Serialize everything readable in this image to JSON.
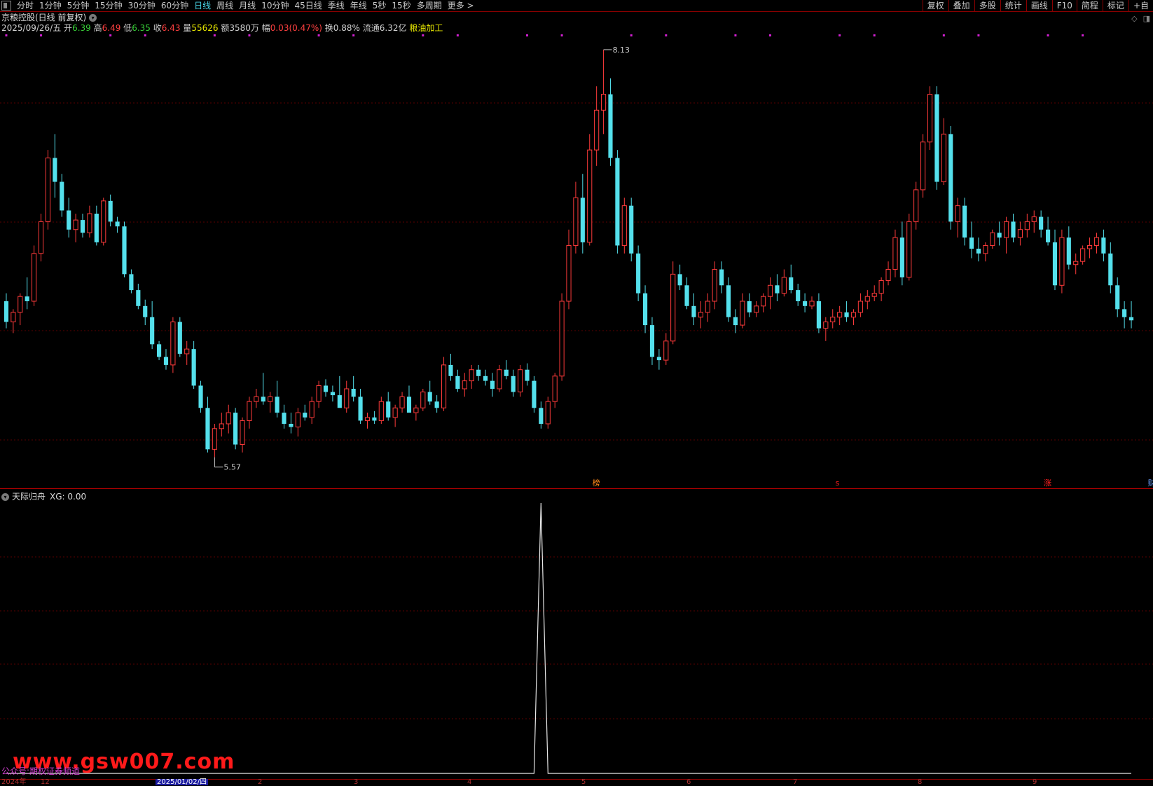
{
  "toolbar": {
    "periods": [
      "分时",
      "1分钟",
      "5分钟",
      "15分钟",
      "30分钟",
      "60分钟",
      "日线",
      "周线",
      "月线",
      "10分钟",
      "45日线",
      "季线",
      "年线",
      "5秒",
      "15秒",
      "多周期",
      "更多 >"
    ],
    "active_period": "日线",
    "right_buttons": [
      "复权",
      "叠加",
      "多股",
      "统计",
      "画线",
      "F10",
      "简程",
      "标记",
      "+自"
    ]
  },
  "stock": {
    "title": "京粮控股(日线 前复权)",
    "date": "2025/09/26/五",
    "open_label": "开",
    "open": "6.39",
    "high_label": "高",
    "high": "6.49",
    "low_label": "低",
    "low": "6.35",
    "close_label": "收",
    "close": "6.43",
    "volume_label": "量",
    "volume": "55626",
    "amount_label": "额",
    "amount": "3580万",
    "change_label": "幅",
    "change": "0.03(0.47%)",
    "turnover_label": "换",
    "turnover": "0.88%",
    "float_label": "流通",
    "float_cap": "6.32亿",
    "sector": "粮油加工"
  },
  "indicator": {
    "name": "天际归舟",
    "value_text": "XG: 0.00"
  },
  "markers": [
    {
      "text": "榜",
      "color": "#ff8a1a"
    },
    {
      "text": "s",
      "color": "#ff2020"
    },
    {
      "text": "涨",
      "color": "#ff2020"
    },
    {
      "text": "财",
      "color": "#6aa0ff"
    }
  ],
  "watermark": {
    "main": "www.gsw007.com",
    "sub": "公众号:期权证券频道"
  },
  "date_axis": {
    "labels": [
      "2024年",
      "12",
      "2025/01/02/四",
      "2",
      "3",
      "4",
      "5",
      "6",
      "7",
      "8",
      "9"
    ],
    "current": "2025/01/02/四"
  },
  "colors": {
    "up": "#ff3b3b",
    "down": "#54e0ec",
    "grid": "#5a0000",
    "indicator_line": "#e8e8e8",
    "signal_dot": "#d020d0"
  },
  "chart_data": {
    "type": "candlestick",
    "title": "京粮控股(日线 前复权)",
    "annotations": [
      {
        "label": "8.13",
        "kind": "max"
      },
      {
        "label": "5.57",
        "kind": "min"
      }
    ],
    "ohlc": [
      [
        6.55,
        6.6,
        6.38,
        6.42
      ],
      [
        6.42,
        6.5,
        6.35,
        6.48
      ],
      [
        6.48,
        6.6,
        6.4,
        6.58
      ],
      [
        6.58,
        6.7,
        6.5,
        6.55
      ],
      [
        6.55,
        6.9,
        6.52,
        6.85
      ],
      [
        6.85,
        7.1,
        6.8,
        7.05
      ],
      [
        7.05,
        7.5,
        7.0,
        7.45
      ],
      [
        7.45,
        7.6,
        7.2,
        7.3
      ],
      [
        7.3,
        7.35,
        7.08,
        7.12
      ],
      [
        7.12,
        7.2,
        6.95,
        7.0
      ],
      [
        7.0,
        7.1,
        6.92,
        7.06
      ],
      [
        7.06,
        7.1,
        6.95,
        6.98
      ],
      [
        6.98,
        7.15,
        6.95,
        7.1
      ],
      [
        7.1,
        7.15,
        6.9,
        6.92
      ],
      [
        6.92,
        7.2,
        6.9,
        7.18
      ],
      [
        7.18,
        7.22,
        7.02,
        7.05
      ],
      [
        7.05,
        7.08,
        6.98,
        7.02
      ],
      [
        7.02,
        7.05,
        6.7,
        6.72
      ],
      [
        6.72,
        6.75,
        6.6,
        6.62
      ],
      [
        6.62,
        6.66,
        6.5,
        6.52
      ],
      [
        6.52,
        6.56,
        6.4,
        6.45
      ],
      [
        6.45,
        6.55,
        6.25,
        6.28
      ],
      [
        6.28,
        6.3,
        6.18,
        6.2
      ],
      [
        6.2,
        6.25,
        6.12,
        6.15
      ],
      [
        6.15,
        6.45,
        6.1,
        6.42
      ],
      [
        6.42,
        6.45,
        6.2,
        6.22
      ],
      [
        6.22,
        6.3,
        6.15,
        6.25
      ],
      [
        6.25,
        6.3,
        6.0,
        6.02
      ],
      [
        6.02,
        6.05,
        5.85,
        5.88
      ],
      [
        5.88,
        5.95,
        5.6,
        5.62
      ],
      [
        5.62,
        5.78,
        5.57,
        5.75
      ],
      [
        5.75,
        5.85,
        5.7,
        5.78
      ],
      [
        5.78,
        5.9,
        5.72,
        5.85
      ],
      [
        5.85,
        5.88,
        5.62,
        5.65
      ],
      [
        5.65,
        5.82,
        5.6,
        5.8
      ],
      [
        5.8,
        5.95,
        5.75,
        5.92
      ],
      [
        5.92,
        6.0,
        5.88,
        5.95
      ],
      [
        5.95,
        6.1,
        5.9,
        5.92
      ],
      [
        5.92,
        5.98,
        5.85,
        5.95
      ],
      [
        5.95,
        6.05,
        5.82,
        5.85
      ],
      [
        5.85,
        5.9,
        5.75,
        5.78
      ],
      [
        5.78,
        5.85,
        5.72,
        5.76
      ],
      [
        5.76,
        5.88,
        5.7,
        5.85
      ],
      [
        5.85,
        5.9,
        5.8,
        5.82
      ],
      [
        5.82,
        5.95,
        5.78,
        5.92
      ],
      [
        5.92,
        6.05,
        5.88,
        6.02
      ],
      [
        6.02,
        6.06,
        5.95,
        5.98
      ],
      [
        5.98,
        6.02,
        5.92,
        5.96
      ],
      [
        5.96,
        6.08,
        5.9,
        5.88
      ],
      [
        5.88,
        6.05,
        5.85,
        6.0
      ],
      [
        6.0,
        6.08,
        5.92,
        5.95
      ],
      [
        5.95,
        6.0,
        5.78,
        5.8
      ],
      [
        5.8,
        5.85,
        5.75,
        5.82
      ],
      [
        5.82,
        5.86,
        5.78,
        5.8
      ],
      [
        5.8,
        5.95,
        5.78,
        5.92
      ],
      [
        5.92,
        5.98,
        5.8,
        5.82
      ],
      [
        5.82,
        5.9,
        5.76,
        5.88
      ],
      [
        5.88,
        5.98,
        5.85,
        5.95
      ],
      [
        5.95,
        6.02,
        5.9,
        5.85
      ],
      [
        5.85,
        5.9,
        5.8,
        5.88
      ],
      [
        5.88,
        6.0,
        5.86,
        5.98
      ],
      [
        5.98,
        6.05,
        5.9,
        5.92
      ],
      [
        5.92,
        5.96,
        5.85,
        5.88
      ],
      [
        5.88,
        6.2,
        5.86,
        6.15
      ],
      [
        6.15,
        6.22,
        6.05,
        6.08
      ],
      [
        6.08,
        6.12,
        5.98,
        6.0
      ],
      [
        6.0,
        6.1,
        5.95,
        6.05
      ],
      [
        6.05,
        6.15,
        6.0,
        6.12
      ],
      [
        6.12,
        6.15,
        6.05,
        6.08
      ],
      [
        6.08,
        6.12,
        6.02,
        6.05
      ],
      [
        6.05,
        6.1,
        5.95,
        6.0
      ],
      [
        6.0,
        6.15,
        5.98,
        6.12
      ],
      [
        6.12,
        6.18,
        6.06,
        6.08
      ],
      [
        6.08,
        6.12,
        5.95,
        5.98
      ],
      [
        5.98,
        6.15,
        5.95,
        6.12
      ],
      [
        6.12,
        6.16,
        6.02,
        6.05
      ],
      [
        6.05,
        6.08,
        5.85,
        5.88
      ],
      [
        5.88,
        5.92,
        5.75,
        5.78
      ],
      [
        5.78,
        5.95,
        5.75,
        5.92
      ],
      [
        5.92,
        6.1,
        5.88,
        6.08
      ],
      [
        6.08,
        6.6,
        6.05,
        6.55
      ],
      [
        6.55,
        7.0,
        6.5,
        6.9
      ],
      [
        6.9,
        7.3,
        6.85,
        7.2
      ],
      [
        7.2,
        7.35,
        6.85,
        6.92
      ],
      [
        6.92,
        7.6,
        6.9,
        7.5
      ],
      [
        7.5,
        7.9,
        7.4,
        7.75
      ],
      [
        7.75,
        8.13,
        7.6,
        7.85
      ],
      [
        7.85,
        7.95,
        7.4,
        7.45
      ],
      [
        7.45,
        7.5,
        6.85,
        6.9
      ],
      [
        6.9,
        7.2,
        6.85,
        7.15
      ],
      [
        7.15,
        7.2,
        6.8,
        6.85
      ],
      [
        6.85,
        6.9,
        6.55,
        6.6
      ],
      [
        6.6,
        6.65,
        6.35,
        6.4
      ],
      [
        6.4,
        6.45,
        6.15,
        6.2
      ],
      [
        6.2,
        6.25,
        6.12,
        6.18
      ],
      [
        6.18,
        6.35,
        6.15,
        6.3
      ],
      [
        6.3,
        6.8,
        6.28,
        6.72
      ],
      [
        6.72,
        6.78,
        6.62,
        6.65
      ],
      [
        6.65,
        6.7,
        6.5,
        6.52
      ],
      [
        6.52,
        6.6,
        6.4,
        6.45
      ],
      [
        6.45,
        6.55,
        6.38,
        6.48
      ],
      [
        6.48,
        6.6,
        6.42,
        6.55
      ],
      [
        6.55,
        6.8,
        6.5,
        6.75
      ],
      [
        6.75,
        6.8,
        6.6,
        6.65
      ],
      [
        6.65,
        6.7,
        6.42,
        6.45
      ],
      [
        6.45,
        6.5,
        6.35,
        6.4
      ],
      [
        6.4,
        6.6,
        6.38,
        6.55
      ],
      [
        6.55,
        6.6,
        6.45,
        6.48
      ],
      [
        6.48,
        6.55,
        6.45,
        6.52
      ],
      [
        6.52,
        6.6,
        6.48,
        6.58
      ],
      [
        6.58,
        6.7,
        6.5,
        6.65
      ],
      [
        6.65,
        6.72,
        6.55,
        6.6
      ],
      [
        6.6,
        6.75,
        6.58,
        6.7
      ],
      [
        6.7,
        6.78,
        6.6,
        6.62
      ],
      [
        6.62,
        6.66,
        6.52,
        6.55
      ],
      [
        6.55,
        6.6,
        6.48,
        6.52
      ],
      [
        6.52,
        6.58,
        6.5,
        6.55
      ],
      [
        6.55,
        6.6,
        6.35,
        6.38
      ],
      [
        6.38,
        6.45,
        6.3,
        6.42
      ],
      [
        6.42,
        6.5,
        6.38,
        6.45
      ],
      [
        6.45,
        6.52,
        6.4,
        6.48
      ],
      [
        6.48,
        6.55,
        6.42,
        6.45
      ],
      [
        6.45,
        6.5,
        6.4,
        6.48
      ],
      [
        6.48,
        6.6,
        6.45,
        6.55
      ],
      [
        6.55,
        6.62,
        6.5,
        6.58
      ],
      [
        6.58,
        6.65,
        6.55,
        6.6
      ],
      [
        6.6,
        6.7,
        6.55,
        6.68
      ],
      [
        6.68,
        6.8,
        6.65,
        6.75
      ],
      [
        6.75,
        7.0,
        6.7,
        6.95
      ],
      [
        6.95,
        7.05,
        6.65,
        6.7
      ],
      [
        6.7,
        7.1,
        6.68,
        7.05
      ],
      [
        7.05,
        7.3,
        7.0,
        7.25
      ],
      [
        7.25,
        7.6,
        7.2,
        7.55
      ],
      [
        7.55,
        7.9,
        7.5,
        7.85
      ],
      [
        7.85,
        7.9,
        7.25,
        7.3
      ],
      [
        7.3,
        7.7,
        7.28,
        7.6
      ],
      [
        7.6,
        7.65,
        7.0,
        7.05
      ],
      [
        7.05,
        7.2,
        6.95,
        7.15
      ],
      [
        7.15,
        7.2,
        6.9,
        6.95
      ],
      [
        6.95,
        7.05,
        6.82,
        6.88
      ],
      [
        6.88,
        6.95,
        6.8,
        6.85
      ],
      [
        6.85,
        6.92,
        6.8,
        6.9
      ],
      [
        6.9,
        7.0,
        6.88,
        6.98
      ],
      [
        6.98,
        7.05,
        6.9,
        6.95
      ],
      [
        6.95,
        7.08,
        6.85,
        7.05
      ],
      [
        7.05,
        7.1,
        6.92,
        6.95
      ],
      [
        6.95,
        7.05,
        6.9,
        7.0
      ],
      [
        7.0,
        7.1,
        6.95,
        7.05
      ],
      [
        7.05,
        7.12,
        6.98,
        7.08
      ],
      [
        7.08,
        7.12,
        6.95,
        7.0
      ],
      [
        7.0,
        7.08,
        6.9,
        6.92
      ],
      [
        6.92,
        7.0,
        6.62,
        6.65
      ],
      [
        6.65,
        7.0,
        6.6,
        6.95
      ],
      [
        6.95,
        7.02,
        6.75,
        6.78
      ],
      [
        6.78,
        6.85,
        6.72,
        6.8
      ],
      [
        6.8,
        6.9,
        6.78,
        6.88
      ],
      [
        6.88,
        6.95,
        6.82,
        6.9
      ],
      [
        6.9,
        6.98,
        6.85,
        6.95
      ],
      [
        6.95,
        7.0,
        6.8,
        6.85
      ],
      [
        6.85,
        6.92,
        6.6,
        6.65
      ],
      [
        6.65,
        6.7,
        6.45,
        6.5
      ],
      [
        6.5,
        6.55,
        6.38,
        6.45
      ],
      [
        6.45,
        6.55,
        6.38,
        6.43
      ]
    ],
    "indicator_series": {
      "name": "XG",
      "values": [
        0,
        0,
        0,
        0,
        0,
        0,
        0,
        0,
        0,
        0,
        0,
        0,
        0,
        0,
        0,
        0,
        0,
        0,
        0,
        0,
        0,
        0,
        0,
        0,
        0,
        0,
        0,
        0,
        0,
        0,
        0,
        0,
        0,
        0,
        0,
        0,
        0,
        0,
        0,
        0,
        0,
        0,
        0,
        0,
        0,
        0,
        0,
        0,
        0,
        0,
        0,
        0,
        0,
        0,
        0,
        0,
        0,
        0,
        0,
        0,
        0,
        0,
        0,
        0,
        0,
        0,
        0,
        0,
        0,
        0,
        0,
        0,
        0,
        0,
        0,
        0,
        0,
        0,
        0,
        0,
        0,
        0,
        0,
        0,
        0,
        0,
        0,
        0,
        0,
        0,
        0,
        0,
        0,
        0,
        0,
        0,
        0,
        0,
        0,
        0,
        0,
        0,
        0,
        0,
        0,
        0,
        0,
        0,
        0,
        0,
        0,
        0,
        0,
        0,
        0,
        0,
        0,
        0,
        0,
        0,
        0,
        0,
        0,
        0,
        0,
        0,
        0,
        0,
        0,
        0,
        0,
        0,
        0,
        0,
        0,
        0,
        0,
        0,
        0,
        0,
        0,
        0,
        0,
        0,
        0,
        0,
        0,
        0,
        0,
        0,
        0,
        0,
        0,
        0,
        0,
        0,
        0,
        0,
        0,
        0,
        0,
        0,
        0,
        0,
        0,
        0,
        0,
        0,
        0,
        0,
        0,
        0,
        0,
        0,
        0,
        0,
        0
      ],
      "spike_index": 77,
      "spike_value": 1
    }
  }
}
